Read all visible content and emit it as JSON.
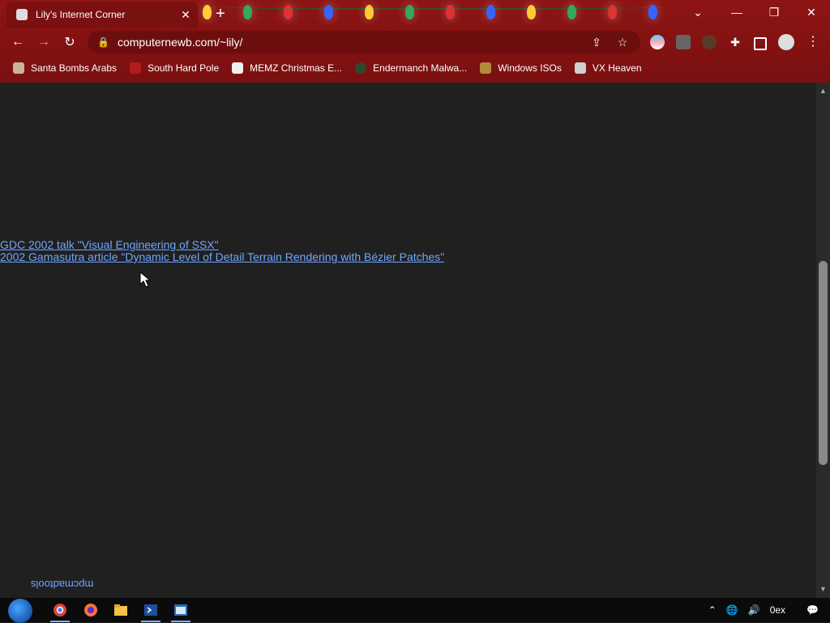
{
  "browser": {
    "tab_title": "Lily's Internet Corner",
    "url": "computernewb.com/~lily/",
    "bookmarks": [
      {
        "label": "Santa Bombs Arabs"
      },
      {
        "label": "South Hard Pole"
      },
      {
        "label": "MEMZ Christmas E..."
      },
      {
        "label": "Endermanch Malwa..."
      },
      {
        "label": "Windows ISOs"
      },
      {
        "label": "VX Heaven"
      }
    ]
  },
  "page": {
    "links": [
      {
        "text": "GDC 2002 talk \"Visual Engineering of SSX\""
      },
      {
        "text": "2002 Gamasutra article \"Dynamic Level of Detail Terrain Rendering with Bézier Patches\""
      }
    ],
    "mirrored_text": "mpcmadtools"
  },
  "taskbar": {
    "tray_text": "0ex"
  },
  "colors": {
    "browser_bg": "#8e1414",
    "page_bg": "#202020",
    "link": "#6ea6ff"
  }
}
